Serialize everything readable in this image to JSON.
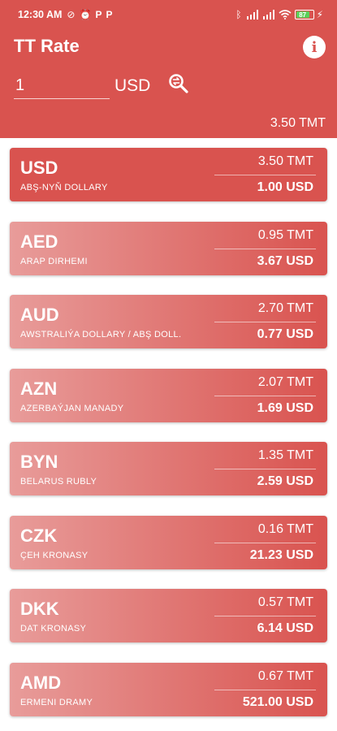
{
  "status_bar": {
    "time": "12:30 AM",
    "left_icons": [
      "signal-off-icon",
      "alarm-icon",
      "parking-app-icon",
      "parking-app-icon"
    ],
    "right_icons": [
      "bluetooth-icon",
      "signal-bars-icon",
      "signal-bars-icon",
      "wifi-icon"
    ],
    "battery_level": "87"
  },
  "header": {
    "title": "TT Rate",
    "amount_value": "1",
    "amount_currency": "USD",
    "rate": "3.50 TMT"
  },
  "colors": {
    "primary": "#d9534f",
    "card_light": "#e89c9a"
  },
  "currencies": [
    {
      "code": "USD",
      "name": "ABŞ-NYŇ DOLLARY",
      "tmt": "3.50 TMT",
      "usd": "1.00 USD"
    },
    {
      "code": "AED",
      "name": "ARAP DIRHEMI",
      "tmt": "0.95 TMT",
      "usd": "3.67 USD"
    },
    {
      "code": "AUD",
      "name": "AWSTRALIÝA DOLLARY / ABŞ DOLL.",
      "tmt": "2.70 TMT",
      "usd": "0.77 USD"
    },
    {
      "code": "AZN",
      "name": "AZERBAÝJAN MANADY",
      "tmt": "2.07 TMT",
      "usd": "1.69 USD"
    },
    {
      "code": "BYN",
      "name": "BELARUS RUBLY",
      "tmt": "1.35 TMT",
      "usd": "2.59 USD"
    },
    {
      "code": "CZK",
      "name": "ÇEH KRONASY",
      "tmt": "0.16 TMT",
      "usd": "21.23 USD"
    },
    {
      "code": "DKK",
      "name": "DAT KRONASY",
      "tmt": "0.57 TMT",
      "usd": "6.14 USD"
    },
    {
      "code": "AMD",
      "name": "ERMENI DRAMY",
      "tmt": "0.67 TMT",
      "usd": "521.00 USD"
    }
  ]
}
